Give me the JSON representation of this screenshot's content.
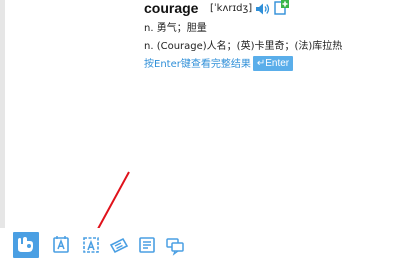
{
  "dictionary": {
    "word": "courage",
    "phonetic": "[ˈkʌrɪdʒ]",
    "definitions": [
      "n. 勇气；胆量",
      "n. (Courage)人名；(英)卡里奇；(法)库拉热"
    ],
    "full_results_hint": "按Enter键查看完整结果",
    "enter_key_label": "↵Enter"
  },
  "colors": {
    "accent": "#4a9fe3",
    "link": "#2f8fd8",
    "annotation_arrow": "#e0121b"
  },
  "toolbar": {
    "tools": [
      {
        "icon": "dictionary-logo-icon",
        "active": true
      },
      {
        "icon": "word-lookup-icon",
        "active": false
      },
      {
        "icon": "screen-capture-translate-icon",
        "active": false
      },
      {
        "icon": "word-card-icon",
        "active": false
      },
      {
        "icon": "translation-icon",
        "active": false
      },
      {
        "icon": "chat-icon",
        "active": false
      }
    ]
  }
}
